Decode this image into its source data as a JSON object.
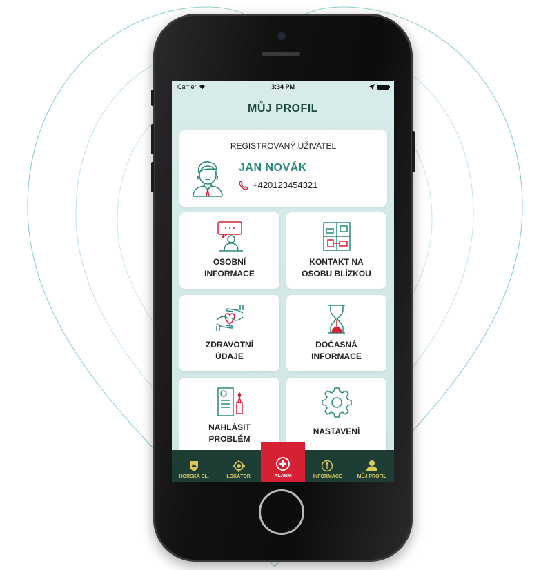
{
  "colors": {
    "accent": "#2a8a7a",
    "title": "#1e4a3f",
    "icon_red": "#d62033",
    "tabbar_bg": "#1e3d34",
    "tab_text": "#d8c95a",
    "alarm_bg": "#d62033",
    "screen_bg": "#d7ecea",
    "rings": "#8ed0ca"
  },
  "status_bar": {
    "carrier": "Carrier",
    "time": "3:34 PM"
  },
  "header": {
    "title": "MŮJ PROFIL"
  },
  "profile": {
    "heading": "REGISTROVANÝ UŽIVATEL",
    "name": "JAN NOVÁK",
    "phone": "+420123454321"
  },
  "tiles": [
    {
      "line1": "OSOBNÍ",
      "line2": "INFORMACE",
      "icon": "person-chat-icon"
    },
    {
      "line1": "KONTAKT NA",
      "line2": "OSOBU BLÍZKOU",
      "icon": "handshake-icon"
    },
    {
      "line1": "ZDRAVOTNÍ",
      "line2": "ÚDAJE",
      "icon": "heart-hands-icon"
    },
    {
      "line1": "DOČASNÁ",
      "line2": "INFORMACE",
      "icon": "hourglass-icon"
    },
    {
      "line1": "NAHLÁSIT",
      "line2": "PROBLÉM",
      "icon": "report-document-icon"
    },
    {
      "line1": "NASTAVENÍ",
      "line2": "",
      "icon": "gear-icon"
    }
  ],
  "tabs": [
    {
      "label": "HORSKÁ SL.",
      "icon": "mountain-rescue-icon"
    },
    {
      "label": "LOKÁTOR",
      "icon": "crosshair-icon"
    },
    {
      "label": "ALARM",
      "icon": "plus-icon"
    },
    {
      "label": "INFORMACE",
      "icon": "info-icon"
    },
    {
      "label": "MŮJ PROFIL",
      "icon": "user-icon"
    }
  ]
}
